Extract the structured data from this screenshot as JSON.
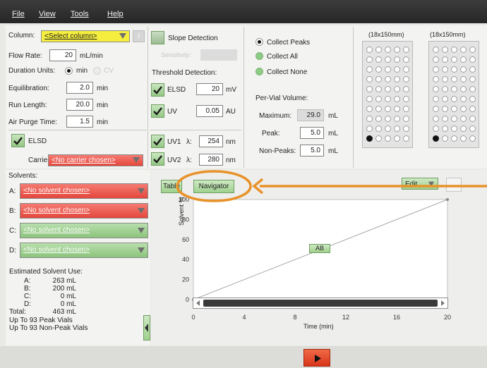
{
  "menu": [
    "File",
    "View",
    "Tools",
    "Help"
  ],
  "column": {
    "label": "Column:",
    "value": "<Select column>",
    "info": "i"
  },
  "flow_rate": {
    "label": "Flow Rate:",
    "value": "20",
    "unit": "mL/min"
  },
  "duration_units": {
    "label": "Duration Units:",
    "opt1": "min",
    "opt2": "CV"
  },
  "equilibration": {
    "label": "Equilibration:",
    "value": "2.0",
    "unit": "min"
  },
  "run_length": {
    "label": "Run Length:",
    "value": "20.0",
    "unit": "min"
  },
  "air_purge": {
    "label": "Air Purge Time:",
    "value": "1.5",
    "unit": "min"
  },
  "elsd_main": {
    "label": "ELSD"
  },
  "carrier": {
    "label": "Carrier:",
    "value": "<No carrier chosen>"
  },
  "slope": {
    "label": "Slope Detection",
    "sensitivity_label": "Sensitivity:"
  },
  "threshold": {
    "label": "Threshold Detection:",
    "elsd_label": "ELSD",
    "elsd_value": "20",
    "elsd_unit": "mV",
    "uv_label": "UV",
    "uv_value": "0.05",
    "uv_unit": "AU"
  },
  "uv1": {
    "label": "UV1",
    "lambda": "λ:",
    "value": "254",
    "unit": "nm"
  },
  "uv2": {
    "label": "UV2",
    "lambda": "λ:",
    "value": "280",
    "unit": "nm"
  },
  "collect": {
    "peaks": "Collect Peaks",
    "all": "Collect All",
    "none": "Collect None"
  },
  "per_vial": {
    "label": "Per-Vial Volume:",
    "maximum_label": "Maximum:",
    "maximum_value": "29.0",
    "maximum_unit": "mL",
    "peak_label": "Peak:",
    "peak_value": "5.0",
    "peak_unit": "mL",
    "nonpeak_label": "Non-Peaks:",
    "nonpeak_value": "5.0",
    "nonpeak_unit": "mL"
  },
  "racks": [
    {
      "label": "(18x150mm)"
    },
    {
      "label": "(18x150mm)"
    }
  ],
  "solvents": {
    "label": "Solvents:",
    "items": [
      {
        "key": "A:",
        "value": "<No solvent chosen>"
      },
      {
        "key": "B:",
        "value": "<No solvent chosen>"
      },
      {
        "key": "C:",
        "value": "<No solvent chosen>"
      },
      {
        "key": "D:",
        "value": "<No solvent chosen>"
      }
    ]
  },
  "usage": {
    "title": "Estimated Solvent Use:",
    "rows": [
      {
        "k": "A:",
        "v": "263 mL"
      },
      {
        "k": "B:",
        "v": "200 mL"
      },
      {
        "k": "C:",
        "v": "0 mL"
      },
      {
        "k": "D:",
        "v": "0 mL"
      },
      {
        "k": "Total:",
        "v": "463 mL"
      }
    ],
    "peak_vials": "Up To 93 Peak Vials",
    "nonpeak_vials": "Up To 93 Non-Peak Vials"
  },
  "tabs": {
    "table": "Table",
    "navigator": "Navigator"
  },
  "edit_label": "Edit",
  "chart_data": {
    "type": "line",
    "xlabel": "Time (min)",
    "ylabel": "Solvent %",
    "x_ticks": [
      "0",
      "4",
      "8",
      "12",
      "16",
      "20"
    ],
    "y_ticks": [
      "0",
      "20",
      "40",
      "60",
      "80",
      "100"
    ],
    "xlim": [
      0,
      20
    ],
    "ylim": [
      0,
      100
    ],
    "series": [
      {
        "name": "AB",
        "x": [
          0,
          20
        ],
        "y": [
          0,
          100
        ]
      }
    ],
    "series_label": "AB"
  },
  "colors": {
    "accent_orange": "#e8922a",
    "run_red": "#e03a1e",
    "menubar": "#2e2e2e"
  }
}
